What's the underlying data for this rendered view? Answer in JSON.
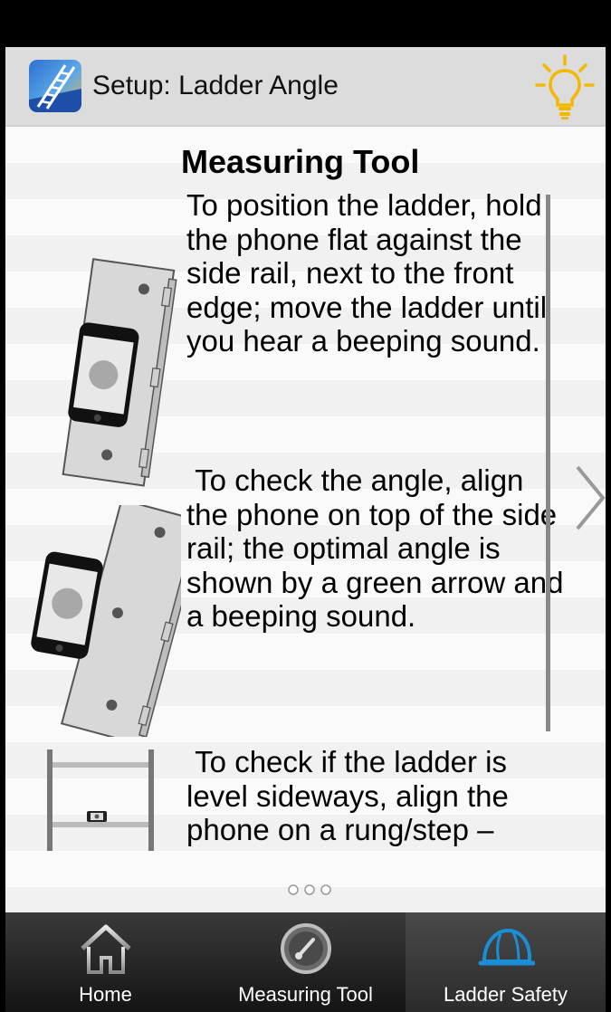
{
  "header": {
    "title": "Setup: Ladder Angle",
    "app_icon": "ladder-app-icon",
    "tip_icon": "lightbulb-icon"
  },
  "main": {
    "heading": "Measuring Tool",
    "paragraphs": [
      "To position the ladder, hold the phone flat against the side rail, next to the front edge; move the ladder until you hear a beeping sound.",
      " To check the angle, align the phone on top of the side rail; the optimal angle is shown by a green arrow and a beeping sound.",
      " To check if the ladder is level sideways, align the phone on a rung/step –"
    ],
    "pager": {
      "pages": 3,
      "current": 1
    },
    "next_icon": "chevron-right-icon"
  },
  "tabs": [
    {
      "label": "Home",
      "icon": "home-icon",
      "selected": false
    },
    {
      "label": "Measuring Tool",
      "icon": "gauge-icon",
      "selected": false
    },
    {
      "label": "Ladder Safety",
      "icon": "hard-hat-icon",
      "selected": true
    }
  ],
  "colors": {
    "appbar": "#dcdcdc",
    "bulb": "#f5b800",
    "tabbar": "#1e1e1e",
    "hard_hat": "#1a8fd6"
  }
}
